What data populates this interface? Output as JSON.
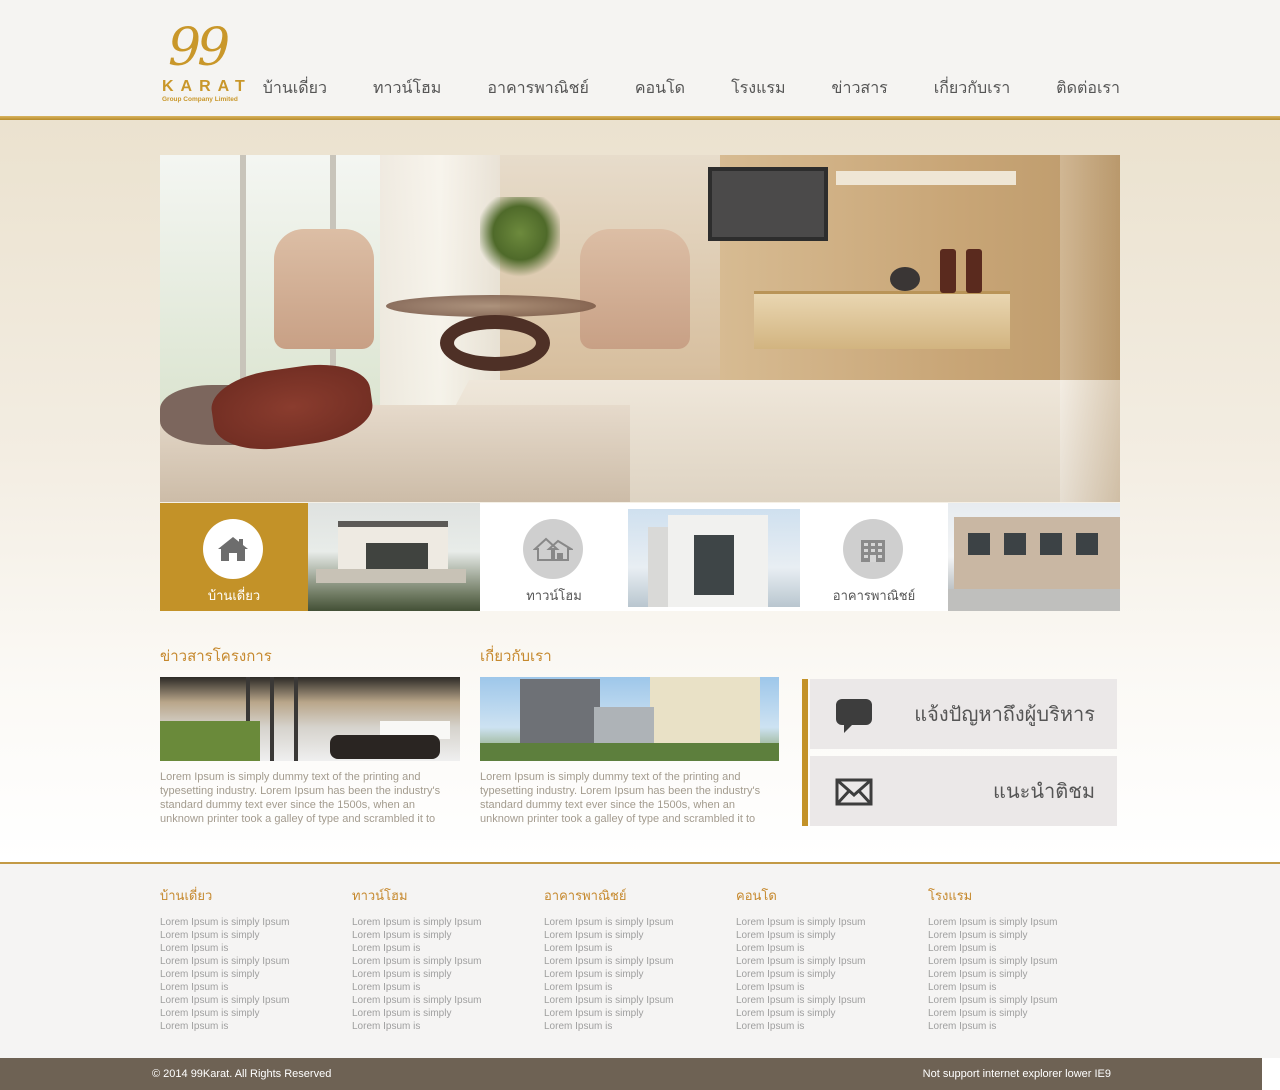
{
  "brand": {
    "logo_number": "99",
    "logo_word": "KARAT",
    "logo_tagline": "Group Company Limited",
    "accent_color": "#c39228"
  },
  "nav": {
    "items": [
      {
        "label": "บ้านเดี่ยว"
      },
      {
        "label": "ทาวน์โฮม"
      },
      {
        "label": "อาคารพาณิชย์"
      },
      {
        "label": "คอนโด"
      },
      {
        "label": "โรงแรม"
      },
      {
        "label": "ข่าวสาร"
      },
      {
        "label": "เกี่ยวกับเรา"
      },
      {
        "label": "ติดต่อเรา"
      }
    ]
  },
  "categories": [
    {
      "label": "บ้านเดี่ยว",
      "icon": "house-icon",
      "active": true
    },
    {
      "label": "ทาวน์โฮม",
      "icon": "townhome-icon",
      "active": false
    },
    {
      "label": "อาคารพาณิชย์",
      "icon": "commercial-building-icon",
      "active": false
    }
  ],
  "news": {
    "title": "ข่าวสารโครงการ",
    "text": "Lorem Ipsum is simply dummy text of the printing and typesetting industry. Lorem Ipsum has been the industry's standard dummy text ever since the 1500s, when an unknown printer took a galley of type and scrambled it to"
  },
  "about": {
    "title": "เกี่ยวกับเรา",
    "text": "Lorem Ipsum is simply dummy text of the printing and typesetting industry. Lorem Ipsum has been the industry's standard dummy text ever since the 1500s, when an unknown printer took a galley of type and scrambled it to"
  },
  "contact": {
    "report_label": "แจ้งปัญหาถึงผู้บริหาร",
    "report_icon": "speech-bubble-icon",
    "feedback_label": "แนะนำติชม",
    "feedback_icon": "envelope-icon"
  },
  "footer": {
    "columns": [
      {
        "title": "บ้านเดี่ยว",
        "items": [
          "Lorem Ipsum is simply Ipsum",
          "Lorem Ipsum is simply",
          "Lorem Ipsum is",
          "Lorem Ipsum is simply Ipsum",
          "Lorem Ipsum is simply",
          "Lorem Ipsum is",
          "Lorem Ipsum is simply Ipsum",
          "Lorem Ipsum is simply",
          "Lorem Ipsum is"
        ]
      },
      {
        "title": "ทาวน์โฮม",
        "items": [
          "Lorem Ipsum is simply Ipsum",
          "Lorem Ipsum is simply",
          "Lorem Ipsum is",
          "Lorem Ipsum is simply Ipsum",
          "Lorem Ipsum is simply",
          "Lorem Ipsum is",
          "Lorem Ipsum is simply Ipsum",
          "Lorem Ipsum is simply",
          "Lorem Ipsum is"
        ]
      },
      {
        "title": "อาคารพาณิชย์",
        "items": [
          "Lorem Ipsum is simply Ipsum",
          "Lorem Ipsum is simply",
          "Lorem Ipsum is",
          "Lorem Ipsum is simply Ipsum",
          "Lorem Ipsum is simply",
          "Lorem Ipsum is",
          "Lorem Ipsum is simply Ipsum",
          "Lorem Ipsum is simply",
          "Lorem Ipsum is"
        ]
      },
      {
        "title": "คอนโด",
        "items": [
          "Lorem Ipsum is simply Ipsum",
          "Lorem Ipsum is simply",
          "Lorem Ipsum is",
          "Lorem Ipsum is simply Ipsum",
          "Lorem Ipsum is simply",
          "Lorem Ipsum is",
          "Lorem Ipsum is simply Ipsum",
          "Lorem Ipsum is simply",
          "Lorem Ipsum is"
        ]
      },
      {
        "title": "โรงแรม",
        "items": [
          "Lorem Ipsum is simply Ipsum",
          "Lorem Ipsum is simply",
          "Lorem Ipsum is",
          "Lorem Ipsum is simply Ipsum",
          "Lorem Ipsum is simply",
          "Lorem Ipsum is",
          "Lorem Ipsum is simply Ipsum",
          "Lorem Ipsum is simply",
          "Lorem Ipsum is"
        ]
      }
    ],
    "copyright": "© 2014 99Karat. All Rights Reserved",
    "support_notice": "Not support internet explorer lower IE9"
  }
}
